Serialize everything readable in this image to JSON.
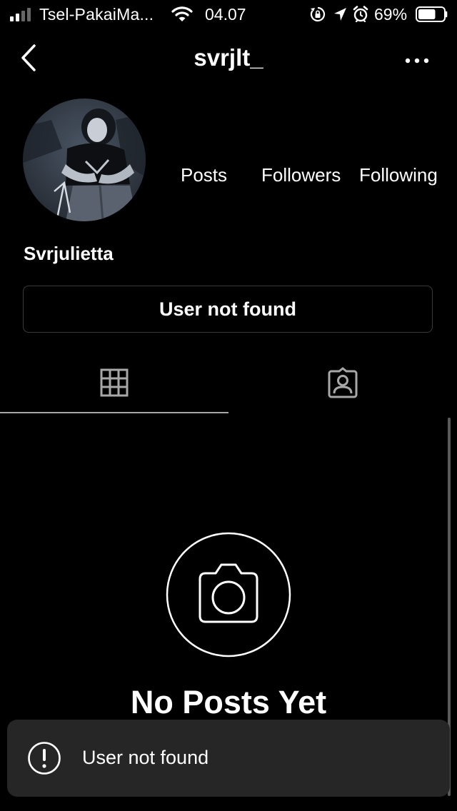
{
  "status_bar": {
    "carrier": "Tsel-PakaiMa...",
    "time": "04.07",
    "battery": "69%",
    "battery_level": 0.69
  },
  "header": {
    "username": "svrjlt_"
  },
  "profile": {
    "full_name": "Svrjulietta",
    "stats": {
      "posts_label": "Posts",
      "followers_label": "Followers",
      "following_label": "Following"
    },
    "action_button_label": "User not found"
  },
  "tabs": {
    "active": "grid"
  },
  "empty_state": {
    "title": "No Posts Yet"
  },
  "toast": {
    "message": "User not found"
  },
  "colors": {
    "background": "#000000",
    "text": "#ffffff",
    "toast_bg": "#262626",
    "border": "#3a3a3a",
    "icon_inactive": "#a8a8a8"
  }
}
